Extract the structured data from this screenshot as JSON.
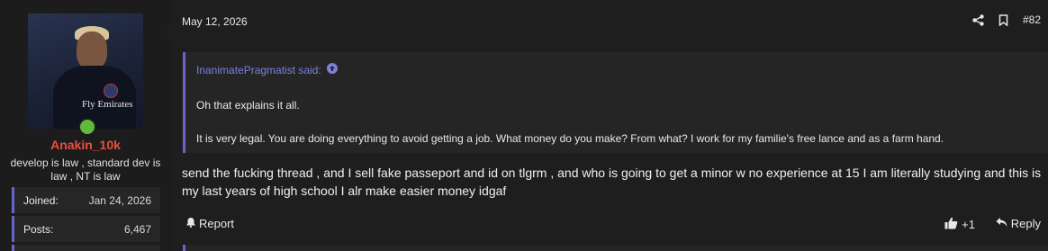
{
  "user": {
    "username": "Anakin_10k",
    "title": "develop is law , standard dev is law , NT is law",
    "username_color": "#e84f3d",
    "online_color": "#63b93a",
    "avatar_text": "Fly Emirates",
    "stats": [
      {
        "label": "Joined:",
        "value": "Jan 24, 2026"
      },
      {
        "label": "Posts:",
        "value": "6,467"
      }
    ]
  },
  "post": {
    "date": "May 12, 2026",
    "number": "#82",
    "icons": [
      "share-icon",
      "bookmark-icon"
    ],
    "quote": {
      "author": "InanimatePragmatist said:",
      "author_color": "#7c7fe0",
      "line1": "Oh that explains it all.",
      "line2": "It is very legal. You are doing everything to avoid getting a job. What money do you make? From what? I work for my familie's free lance and as a farm hand."
    },
    "message": "send the fucking thread , and I sell fake passeport and id on tlgrm , and who is going to get a minor w no experience at 15 I am literally studying and this is my last years of high school I alr make easier money idgaf",
    "actions": {
      "report": "Report",
      "reaction": "+1",
      "reply": "Reply"
    }
  },
  "accent": "#6b64c9"
}
